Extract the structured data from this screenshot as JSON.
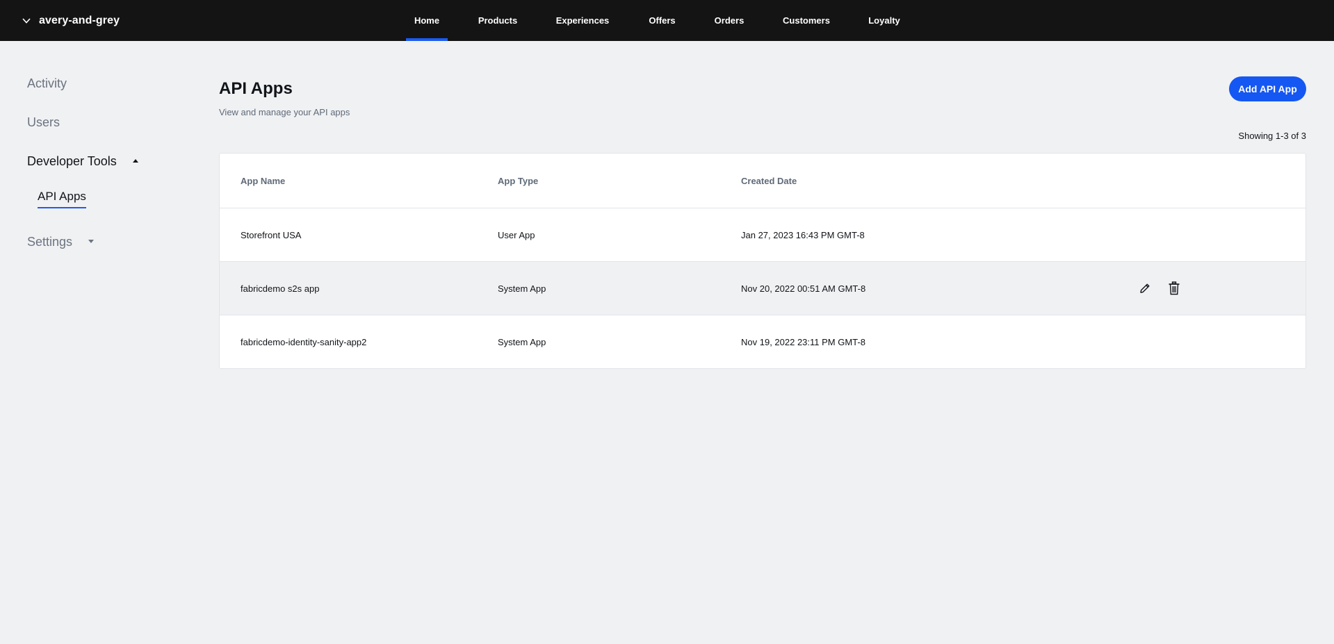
{
  "topbar": {
    "org_name": "avery-and-grey",
    "nav": [
      {
        "label": "Home",
        "active": true
      },
      {
        "label": "Products",
        "active": false
      },
      {
        "label": "Experiences",
        "active": false
      },
      {
        "label": "Offers",
        "active": false
      },
      {
        "label": "Orders",
        "active": false
      },
      {
        "label": "Customers",
        "active": false
      },
      {
        "label": "Loyalty",
        "active": false
      }
    ]
  },
  "sidebar": {
    "items": [
      {
        "label": "Activity"
      },
      {
        "label": "Users"
      },
      {
        "label": "Developer Tools",
        "expanded": true,
        "children": [
          {
            "label": "API Apps",
            "selected": true
          }
        ]
      },
      {
        "label": "Settings",
        "expanded": false
      }
    ]
  },
  "page": {
    "title": "API Apps",
    "subtitle": "View and manage your API apps",
    "add_button": "Add API App",
    "showing": "Showing 1-3 of 3"
  },
  "table": {
    "columns": [
      "App Name",
      "App Type",
      "Created Date"
    ],
    "rows": [
      {
        "name": "Storefront USA",
        "type": "User App",
        "created": "Jan 27, 2023 16:43 PM GMT-8"
      },
      {
        "name": "fabricdemo s2s app",
        "type": "System App",
        "created": "Nov 20, 2022 00:51 AM GMT-8"
      },
      {
        "name": "fabricdemo-identity-sanity-app2",
        "type": "System App",
        "created": "Nov 19, 2022 23:11 PM GMT-8"
      }
    ],
    "hovered_row": 1
  },
  "icons": {
    "org_switch": "chevron-down-icon",
    "edit": "pencil-icon",
    "delete": "trash-icon"
  },
  "colors": {
    "topbar_bg": "#141414",
    "accent": "#1557f2",
    "page_bg": "#f0f1f3"
  }
}
